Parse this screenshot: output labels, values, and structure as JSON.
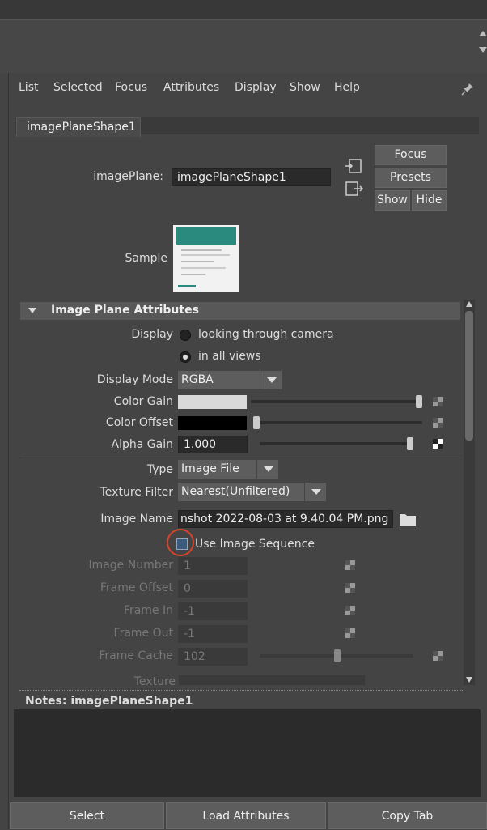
{
  "menu": {
    "items": [
      "List",
      "Selected",
      "Focus",
      "Attributes",
      "Display",
      "Show",
      "Help"
    ]
  },
  "tab": {
    "label": "imagePlaneShape1"
  },
  "header": {
    "node_label": "imagePlane:",
    "node_value": "imagePlaneShape1",
    "focus": "Focus",
    "presets": "Presets",
    "show": "Show",
    "hide": "Hide",
    "sample_label": "Sample"
  },
  "section": {
    "title": "Image Plane Attributes"
  },
  "attrs": {
    "display_label": "Display",
    "display_opt1": "looking through camera",
    "display_opt2": "in all views",
    "display_selected": "in all views",
    "display_mode_label": "Display Mode",
    "display_mode_value": "RGBA",
    "color_gain_label": "Color Gain",
    "color_gain_color": "#d9d9d9",
    "color_gain_level": 1.0,
    "color_offset_label": "Color Offset",
    "color_offset_color": "#000000",
    "color_offset_level": 0.0,
    "alpha_gain_label": "Alpha Gain",
    "alpha_gain_value": "1.000",
    "type_label": "Type",
    "type_value": "Image File",
    "texture_filter_label": "Texture Filter",
    "texture_filter_value": "Nearest(Unfiltered)",
    "image_name_label": "Image Name",
    "image_name_value": "nshot 2022-08-03 at 9.40.04 PM.png",
    "use_seq_label": "Use Image Sequence",
    "image_number_label": "Image Number",
    "image_number_value": "1",
    "frame_offset_label": "Frame Offset",
    "frame_offset_value": "0",
    "frame_in_label": "Frame In",
    "frame_in_value": "-1",
    "frame_out_label": "Frame Out",
    "frame_out_value": "-1",
    "frame_cache_label": "Frame Cache",
    "frame_cache_value": "102",
    "texture_label": "Texture"
  },
  "notes": {
    "label": "Notes:  imagePlaneShape1"
  },
  "bottom": {
    "select": "Select",
    "load": "Load Attributes",
    "copy": "Copy Tab"
  },
  "colors": {
    "accent_circle": "#d9432b",
    "panel_bg": "#444444"
  }
}
